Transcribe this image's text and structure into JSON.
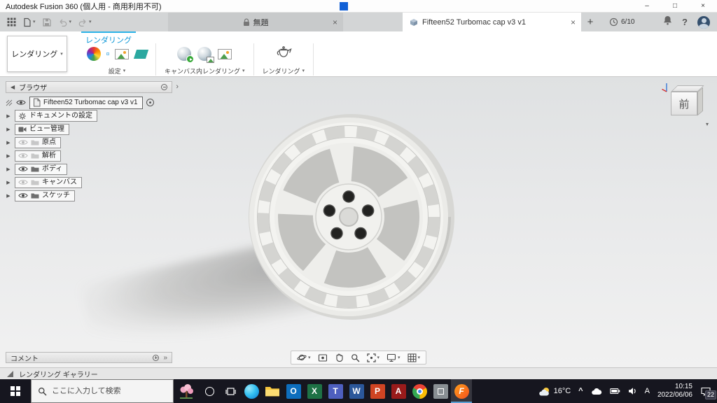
{
  "titlebar": {
    "title": "Autodesk Fusion 360 (個人用 - 商用利用不可)"
  },
  "tabbar": {
    "doc_tabs": [
      {
        "label": "無題"
      },
      {
        "label": "Fifteen52 Turbomac cap v3 v1"
      }
    ],
    "quota": "6/10"
  },
  "ribbon": {
    "workspace": "レンダリング",
    "tab": "レンダリング",
    "groups": [
      {
        "label": "設定"
      },
      {
        "label": "キャンバス内レンダリング"
      },
      {
        "label": "レンダリング"
      }
    ]
  },
  "browser": {
    "title": "ブラウザ",
    "root_label": "Fifteen52 Turbomac cap v3 v1",
    "items": [
      {
        "label": "ドキュメントの設定",
        "icon": "gear"
      },
      {
        "label": "ビュー管理",
        "icon": "camera"
      },
      {
        "label": "原点",
        "icon": "folder",
        "visibility": "off"
      },
      {
        "label": "解析",
        "icon": "folder",
        "visibility": "off"
      },
      {
        "label": "ボディ",
        "icon": "folder",
        "visibility": "on"
      },
      {
        "label": "キャンバス",
        "icon": "folder",
        "visibility": "off"
      },
      {
        "label": "スケッチ",
        "icon": "folder",
        "visibility": "on"
      }
    ]
  },
  "viewcube": {
    "front": "前"
  },
  "viewport_toolbar": {
    "comments": "コメント"
  },
  "gallery": {
    "label": "レンダリング ギャラリー"
  },
  "taskbar": {
    "search_placeholder": "ここに入力して検索",
    "apps": [
      {
        "name": "edge",
        "glyph": ""
      },
      {
        "name": "file-explorer",
        "glyph": ""
      },
      {
        "name": "outlook",
        "glyph": "O"
      },
      {
        "name": "excel",
        "glyph": "X"
      },
      {
        "name": "teams",
        "glyph": "T"
      },
      {
        "name": "word",
        "glyph": "W"
      },
      {
        "name": "powerpoint",
        "glyph": "P"
      },
      {
        "name": "acrobat",
        "glyph": "A"
      },
      {
        "name": "chrome",
        "glyph": ""
      },
      {
        "name": "autodesk",
        "glyph": ""
      },
      {
        "name": "fusion-360",
        "glyph": "F",
        "active": true
      }
    ],
    "weather_temp": "16°C",
    "ime_mode": "A",
    "time": "10:15",
    "date": "2022/06/06",
    "notification_count": "22"
  },
  "icons": {
    "caret_down": "▾",
    "close": "×",
    "new_tab": "+",
    "help": "?",
    "minimize": "–",
    "maximize": "□",
    "expander": "▶",
    "collapse": "◀",
    "chevrons": "»",
    "flyout": "›",
    "chevron_up": "^"
  },
  "colors": {
    "accent": "#2bb3e8",
    "fusion_orange": "#f4511e"
  }
}
